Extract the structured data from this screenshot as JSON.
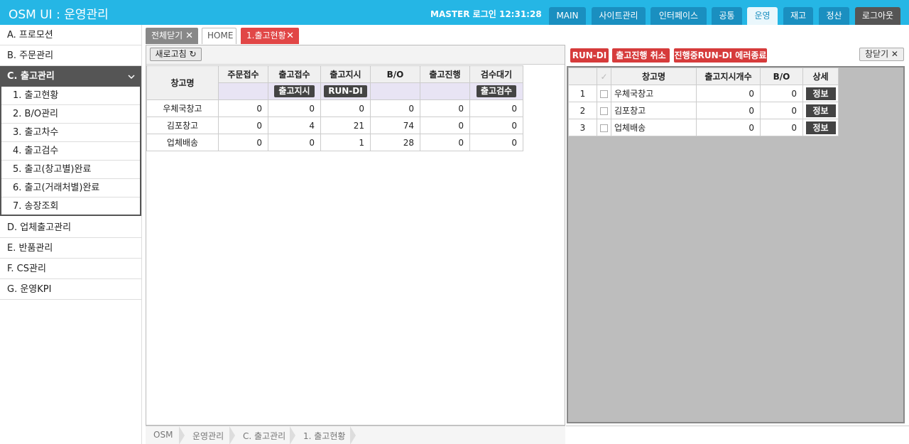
{
  "app": {
    "title": "OSM UI : 운영관리",
    "login_info": "MASTER 로그인 12:31:28"
  },
  "topnav": [
    {
      "label": "MAIN",
      "state": "normal"
    },
    {
      "label": "사이트관리",
      "state": "normal"
    },
    {
      "label": "인터페이스",
      "state": "normal"
    },
    {
      "label": "공통",
      "state": "normal"
    },
    {
      "label": "운영",
      "state": "active"
    },
    {
      "label": "재고",
      "state": "normal"
    },
    {
      "label": "정산",
      "state": "normal"
    },
    {
      "label": "로그아웃",
      "state": "dark"
    }
  ],
  "sidebar": {
    "items": [
      {
        "label": "A. 프로모션"
      },
      {
        "label": "B. 주문관리"
      },
      {
        "label": "C. 출고관리",
        "expanded": true
      },
      {
        "label": "D. 업체출고관리"
      },
      {
        "label": "E. 반품관리"
      },
      {
        "label": "F. CS관리"
      },
      {
        "label": "G. 운영KPI"
      }
    ],
    "submenu": [
      {
        "label": "1. 출고현황"
      },
      {
        "label": "2. B/O관리"
      },
      {
        "label": "3. 출고차수"
      },
      {
        "label": "4. 출고검수"
      },
      {
        "label": "5. 출고(창고별)완료"
      },
      {
        "label": "6. 출고(거래처별)완료"
      },
      {
        "label": "7. 송장조회"
      }
    ]
  },
  "tabs": [
    {
      "label": "전체닫기",
      "close": "✕"
    },
    {
      "label": "HOME"
    },
    {
      "label": "1.출고현황",
      "close": "✕",
      "active": true
    }
  ],
  "left": {
    "refresh_label": "새로고침 ↻",
    "columns": [
      "창고명",
      "주문접수",
      "출고접수",
      "출고지시",
      "B/O",
      "출고진행",
      "검수대기"
    ],
    "action_buttons": {
      "ship_receive": "출고지시",
      "ship_order": "RUN-DI",
      "inspect": "출고검수"
    },
    "rows": [
      {
        "name": "우체국창고",
        "values": [
          "0",
          "0",
          "0",
          "0",
          "0",
          "0"
        ]
      },
      {
        "name": "김포창고",
        "values": [
          "0",
          "4",
          "21",
          "74",
          "0",
          "0"
        ]
      },
      {
        "name": "업체배송",
        "values": [
          "0",
          "0",
          "1",
          "28",
          "0",
          "0"
        ]
      }
    ]
  },
  "breadcrumb": [
    "OSM",
    "운영관리",
    "C. 출고관리",
    "1. 출고현황"
  ],
  "right": {
    "buttons": [
      "RUN-DI",
      "출고진행 취소",
      "진행중RUN-DI 에러종료"
    ],
    "close_label": "창닫기 ✕",
    "columns": [
      "",
      "✓",
      "창고명",
      "출고지시개수",
      "B/O",
      "상세"
    ],
    "info_label": "정보",
    "rows": [
      {
        "idx": "1",
        "name": "우체국창고",
        "count": "0",
        "bo": "0"
      },
      {
        "idx": "2",
        "name": "김포창고",
        "count": "0",
        "bo": "0"
      },
      {
        "idx": "3",
        "name": "업체배송",
        "count": "0",
        "bo": "0"
      }
    ]
  },
  "colors": {
    "brand": "#25b6e5",
    "dark": "#555555",
    "red": "#d63b3b"
  }
}
